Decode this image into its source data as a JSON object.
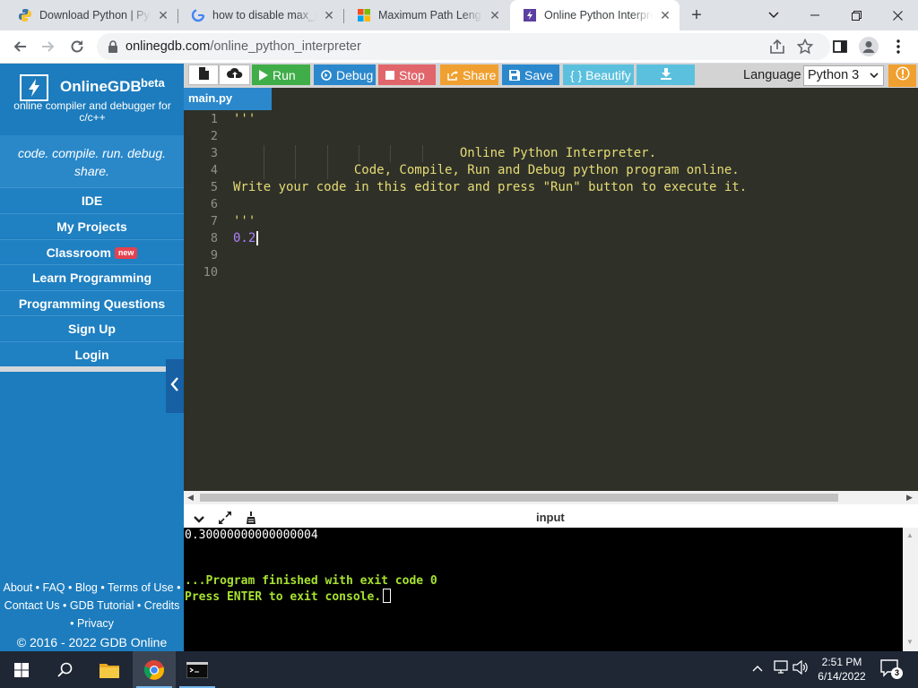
{
  "browser": {
    "tabs": [
      {
        "title": "Download Python | Pyt",
        "favicon": "python-icon"
      },
      {
        "title": "how to disable max_pa",
        "favicon": "google-icon"
      },
      {
        "title": "Maximum Path Length",
        "favicon": "microsoft-icon"
      },
      {
        "title": "Online Python Interpre",
        "favicon": "onlinegdb-icon"
      }
    ],
    "active_tab_index": 3,
    "new_tab_symbol": "+",
    "url_host": "onlinegdb.com",
    "url_path": "/online_python_interpreter"
  },
  "sidebar": {
    "brand": "OnlineGDB",
    "beta": "beta",
    "subtitle": "online compiler and debugger for c/c++",
    "tagline": "code. compile. run. debug. share.",
    "nav": [
      {
        "label": "IDE"
      },
      {
        "label": "My Projects"
      },
      {
        "label": "Classroom",
        "badge": "new"
      },
      {
        "label": "Learn Programming"
      },
      {
        "label": "Programming Questions"
      },
      {
        "label": "Sign Up"
      },
      {
        "label": "Login"
      }
    ],
    "footer": {
      "about": "About",
      "faq": "FAQ",
      "blog": "Blog",
      "terms": "Terms of Use",
      "contact": "Contact Us",
      "gdb_tutorial": "GDB Tutorial",
      "credits": "Credits",
      "privacy": "Privacy",
      "copyright": "© 2016 - 2022 GDB Online"
    }
  },
  "ide_toolbar": {
    "run": "Run",
    "debug": "Debug",
    "stop": "Stop",
    "share": "Share",
    "save": "Save",
    "beautify": "{ } Beautify",
    "language_label": "Language",
    "language_value": "Python 3"
  },
  "editor": {
    "file_tab": "main.py",
    "lines": [
      {
        "n": "1",
        "text": "'''"
      },
      {
        "n": "2",
        "text": ""
      },
      {
        "n": "3",
        "text": "                              Online Python Interpreter."
      },
      {
        "n": "4",
        "text": "                Code, Compile, Run and Debug python program online."
      },
      {
        "n": "5",
        "text": "Write your code in this editor and press \"Run\" button to execute it."
      },
      {
        "n": "6",
        "text": ""
      },
      {
        "n": "7",
        "text": "'''"
      },
      {
        "n": "8",
        "text": "0.2"
      },
      {
        "n": "9",
        "text": ""
      },
      {
        "n": "10",
        "text": ""
      }
    ]
  },
  "console": {
    "title": "input",
    "output_value": "0.30000000000000004",
    "finished": "...Program finished with exit code 0",
    "press_enter": "Press ENTER to exit console."
  },
  "taskbar": {
    "time": "2:51 PM",
    "date": "6/14/2022",
    "notification_count": "3"
  },
  "colors": {
    "sidebar": "#1c7cbd",
    "run": "#3fae49",
    "debug": "#2b88cc",
    "stop": "#e0666b",
    "share": "#f0a030",
    "save": "#2b88cc",
    "beautify": "#5bc0de",
    "download": "#5bc0de",
    "editor_bg": "#2f3129",
    "string": "#e6db74",
    "number": "#ae81ff"
  }
}
